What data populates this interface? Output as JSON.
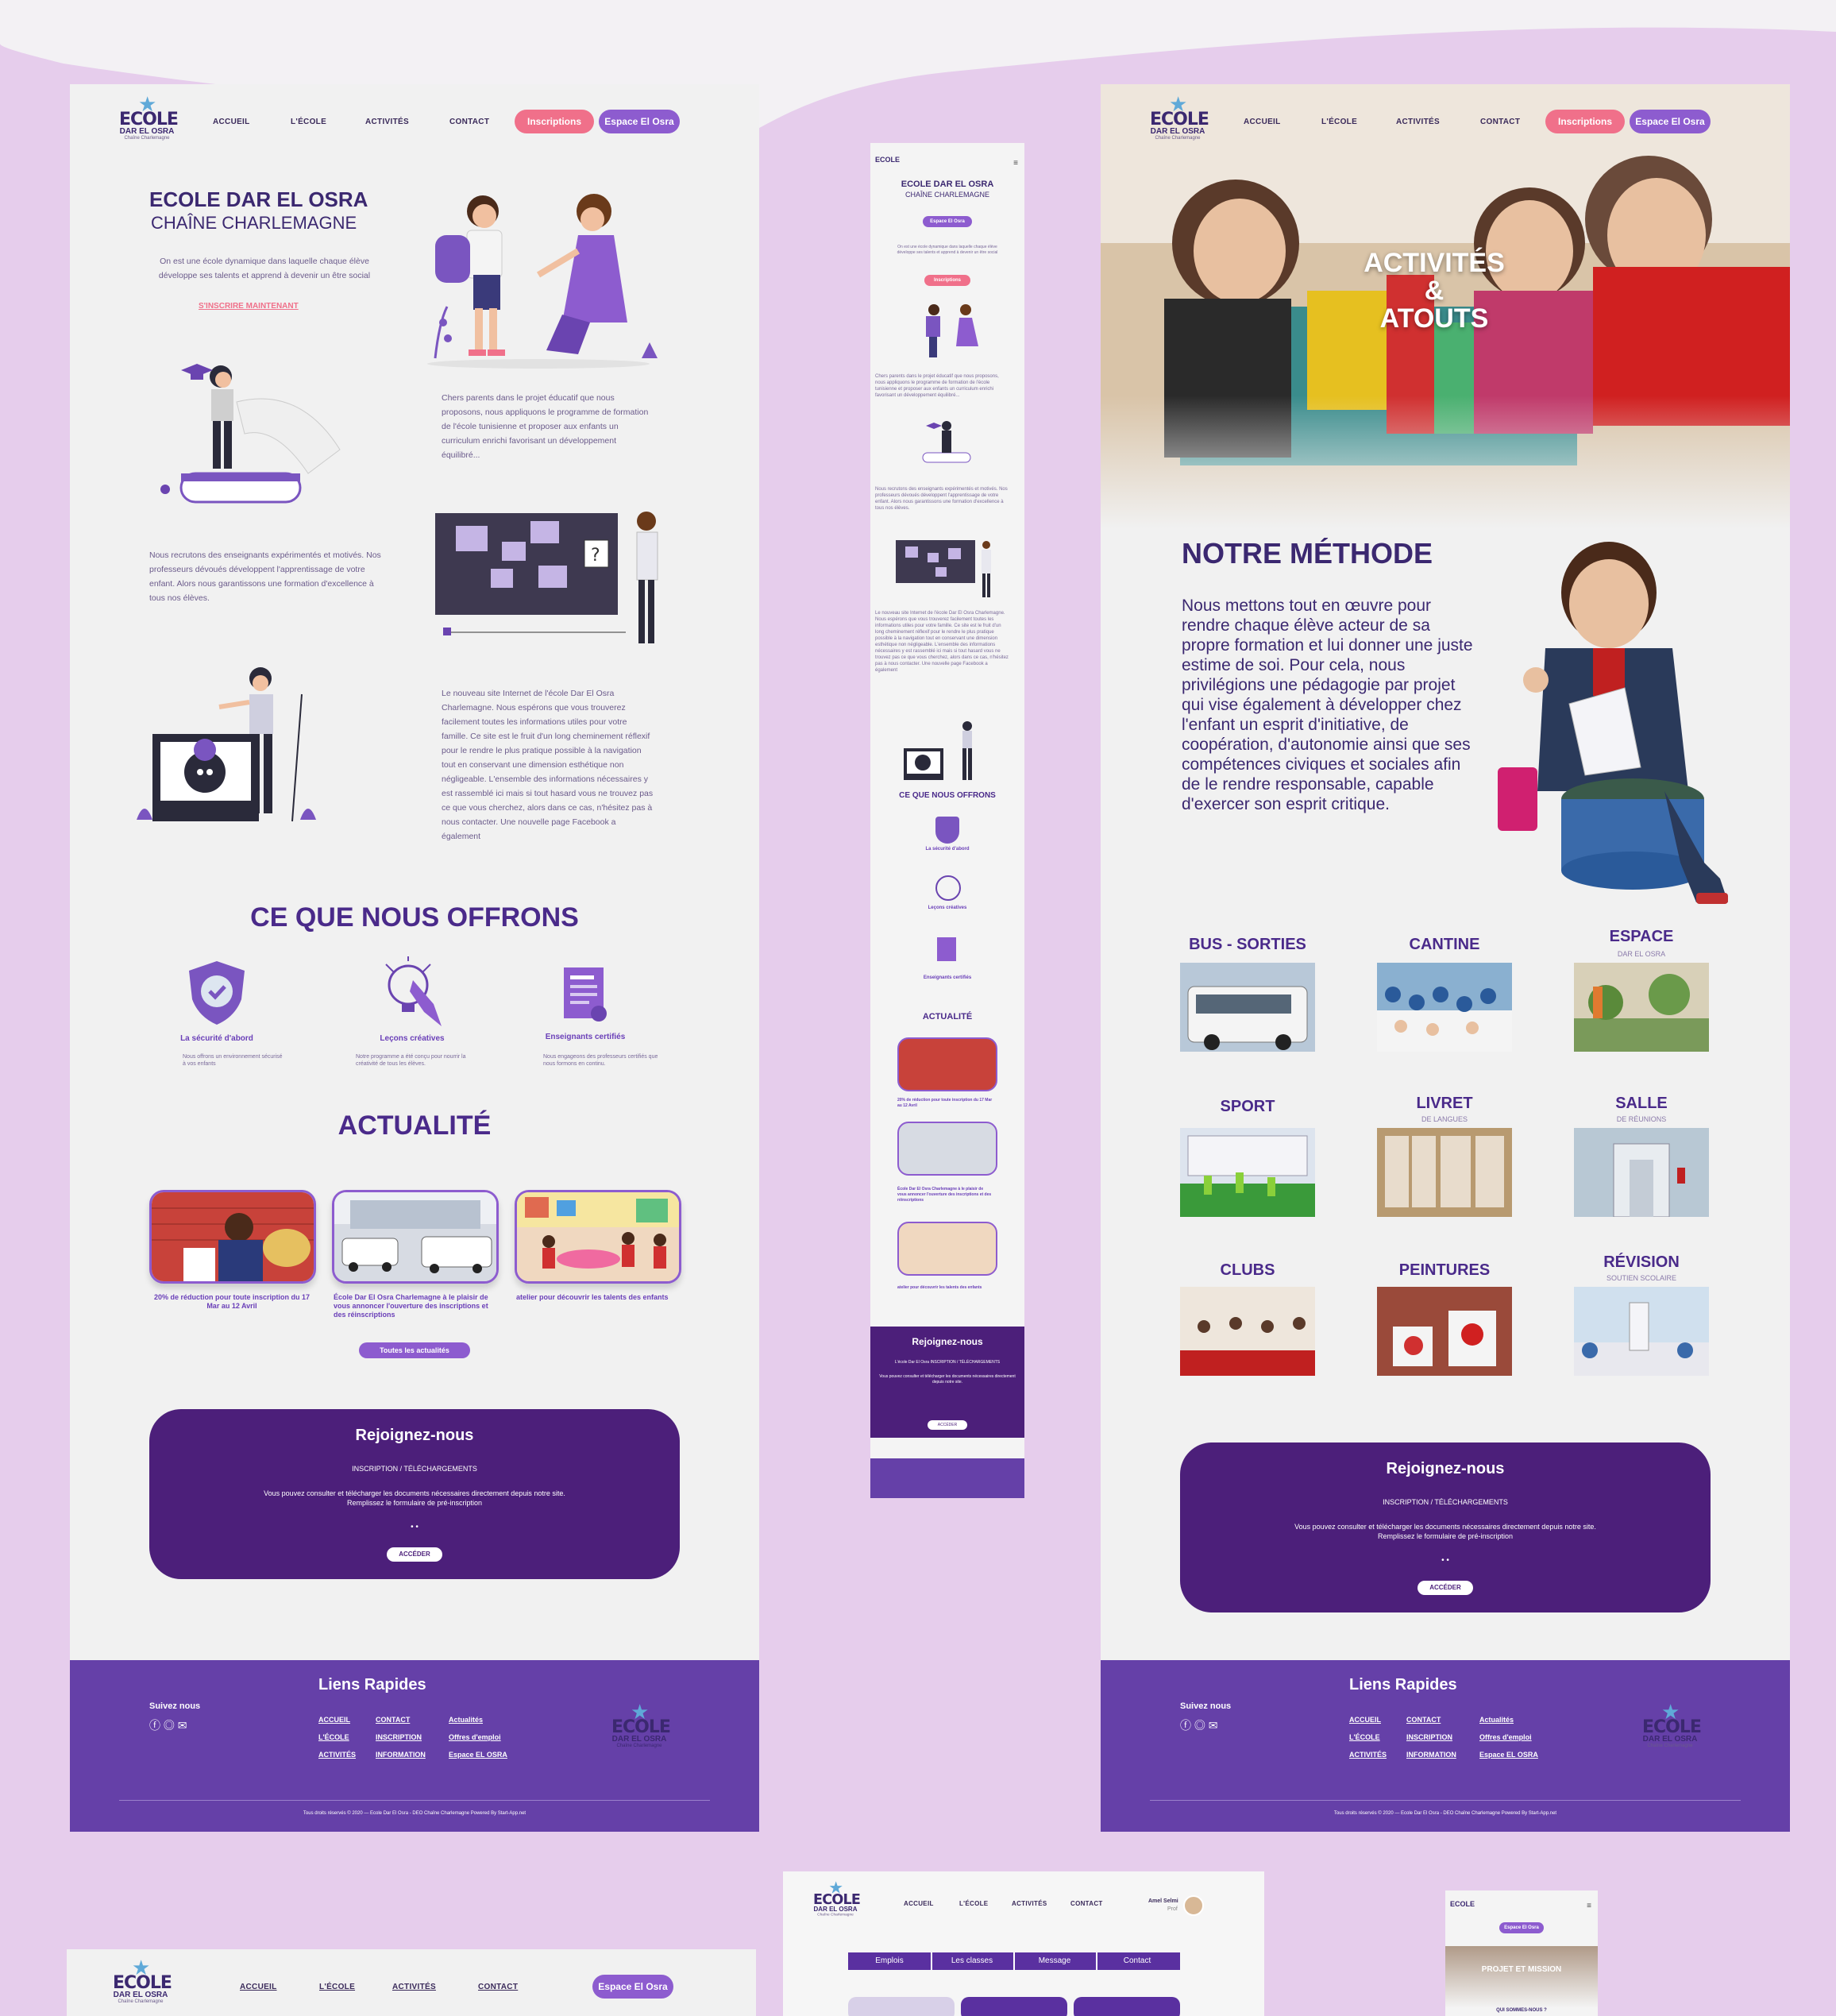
{
  "colors": {
    "background": "#e6cdec",
    "purple_dark": "#4c1f7a",
    "purple": "#6540a8",
    "accent_purple": "#8d5ccf",
    "pink": "#f0708a"
  },
  "nav": {
    "accueil": "ACCUEIL",
    "ecole": "L'ÉCOLE",
    "activites": "ACTIVITÉS",
    "contact": "CONTACT",
    "inscriptions": "Inscriptions",
    "espace": "Espace El Osra"
  },
  "logo": {
    "line1": "ECOLE",
    "line2": "DAR EL OSRA",
    "line3": "Chaîne Charlemagne"
  },
  "home": {
    "title": "ECOLE DAR EL OSRA",
    "subtitle": "CHAÎNE CHARLEMAGNE",
    "intro": "On est une école dynamique dans laquelle chaque élève développe ses talents et apprend à devenir un être social",
    "cta": "S'INSCRIRE MAINTENANT",
    "para1": "Chers parents dans le projet éducatif que nous proposons, nous appliquons le programme de formation de l'école tunisienne et proposer aux enfants un curriculum enrichi favorisant un développement équilibré...",
    "para2": "Nous recrutons des enseignants expérimentés et motivés. Nos professeurs dévoués développent l'apprentissage de votre enfant. Alors nous garantissons une formation d'excellence à tous nos élèves.",
    "para3": "Le nouveau site Internet de l'école Dar El Osra Charlemagne. Nous espérons que vous trouverez facilement toutes les informations utiles pour votre famille. Ce site est le fruit d'un long cheminement réflexif pour le rendre le plus pratique possible à la navigation tout en conservant une dimension esthétique non négligeable. L'ensemble des informations nécessaires y est rassemblé ici mais si tout hasard vous ne trouvez pas ce que vous cherchez, alors dans ce cas, n'hésitez pas à nous contacter. Une nouvelle page Facebook a également",
    "offer_title": "CE QUE NOUS OFFRONS",
    "offers": [
      {
        "title": "La sécurité d'abord",
        "desc": "Nous offrons un environnement sécurisé à vos enfants"
      },
      {
        "title": "Leçons créatives",
        "desc": "Notre programme a été conçu pour nourrir la créativité de tous les élèves."
      },
      {
        "title": "Enseignants certifiés",
        "desc": "Nous engageons des professeurs certifiés que nous formons en continu."
      }
    ],
    "news_title": "ACTUALITÉ",
    "news": [
      "20% de réduction pour toute inscription du 17 Mar au 12 Avril",
      "École Dar El Osra Charlemagne à le plaisir de vous annoncer l'ouverture des inscriptions et des réinscriptions",
      "atelier pour découvrir les talents des enfants"
    ],
    "news_btn": "Toutes les actualités"
  },
  "join": {
    "title": "Rejoignez-nous",
    "sub": "INSCRIPTION / TÉLÉCHARGEMENTS",
    "desc1": "Vous pouvez consulter et télécharger les documents nécessaires directement depuis notre site.",
    "desc2": "Remplissez le formulaire de pré-inscription",
    "button": "ACCÉDER",
    "dots": "• •"
  },
  "footer": {
    "follow": "Suivez nous",
    "links_title": "Liens Rapides",
    "col1": [
      "ACCUEIL",
      "L'ÉCOLE",
      "ACTIVITÉS"
    ],
    "col2": [
      "CONTACT",
      "INSCRIPTION",
      "INFORMATION"
    ],
    "col3": [
      "Actualités",
      "Offres d'emploi",
      "Espace EL OSRA"
    ],
    "copyright": "Tous droits réservés © 2020 — Ecole Dar El Osra - DEO Chaîne Charlemagne   Powered By Start-App.net"
  },
  "activities": {
    "hero1": "ACTIVITÉS",
    "hero2": "&",
    "hero3": "ATOUTS",
    "method_title": "NOTRE MÉTHODE",
    "method_text": "Nous mettons tout en œuvre pour rendre chaque élève acteur de sa propre formation et lui donner une juste estime de soi. Pour cela, nous privilégions une pédagogie par projet qui vise également à développer chez l'enfant un esprit d'initiative, de coopération, d'autonomie ainsi que ses compétences civiques et sociales afin de le rendre responsable, capable d'exercer son esprit critique.",
    "items": [
      {
        "title": "BUS - SORTIES",
        "sub": ""
      },
      {
        "title": "CANTINE",
        "sub": ""
      },
      {
        "title": "ESPACE",
        "sub": "DAR EL OSRA"
      },
      {
        "title": "SPORT",
        "sub": ""
      },
      {
        "title": "LIVRET",
        "sub": "DE LANGUES"
      },
      {
        "title": "SALLE",
        "sub": "DE RÉUNIONS"
      },
      {
        "title": "CLUBS",
        "sub": ""
      },
      {
        "title": "PEINTURES",
        "sub": ""
      },
      {
        "title": "RÉVISION",
        "sub": "SOUTIEN SCOLAIRE"
      }
    ]
  },
  "mobile": {
    "title": "ECOLE DAR EL OSRA",
    "subtitle": "CHAÎNE CHARLEMAGNE",
    "espace": "Espace El Osra",
    "inscriptions": "Inscriptions",
    "offer_title": "CE QUE NOUS OFFRONS",
    "news_title": "ACTUALITÉ",
    "join_title": "Rejoignez-nous",
    "join_sub": "L'école Dar El Osra INSCRIPTION / TÉLÉCHARGEMENTS",
    "accede": "ACCÉDER"
  },
  "dashboard": {
    "user_name": "Amel Selmi",
    "user_role": "Prof",
    "tabs": [
      "Emplois",
      "Les classes",
      "Message",
      "Contact"
    ]
  },
  "mobile2": {
    "espace": "Espace El Osra",
    "hero": "PROJET ET MISSION",
    "sub": "QUI SOMMES-NOUS ?"
  }
}
